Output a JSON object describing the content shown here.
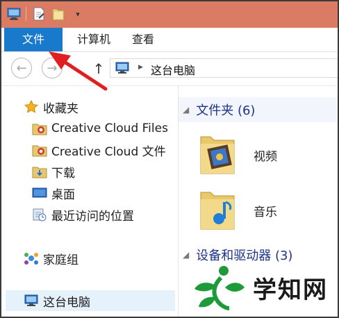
{
  "ribbon": {
    "tabs": [
      {
        "label": "文件"
      },
      {
        "label": "计算机"
      },
      {
        "label": "查看"
      }
    ]
  },
  "address": {
    "path": "这台电脑"
  },
  "nav": {
    "favorites_label": "收藏夹",
    "items": [
      {
        "label": "Creative Cloud Files",
        "icon": "cc-folder-icon"
      },
      {
        "label": "Creative Cloud 文件",
        "icon": "cc-folder-icon"
      },
      {
        "label": "下载",
        "icon": "download-folder-icon"
      },
      {
        "label": "桌面",
        "icon": "desktop-icon"
      },
      {
        "label": "最近访问的位置",
        "icon": "recent-places-icon"
      }
    ],
    "homegroup_label": "家庭组",
    "thispc_label": "这台电脑"
  },
  "content": {
    "folders_group": "文件夹 (6)",
    "devices_group": "设备和驱动器 (3)",
    "folders": [
      {
        "label": "视频",
        "icon": "videos-folder-icon"
      },
      {
        "label": "音乐",
        "icon": "music-folder-icon"
      }
    ]
  },
  "watermark": {
    "text": "学知网"
  },
  "colors": {
    "titlebar": "#dc7b63",
    "file_tab": "#1979ca",
    "group_header": "#1e3287",
    "annotation_arrow": "#e02020"
  }
}
